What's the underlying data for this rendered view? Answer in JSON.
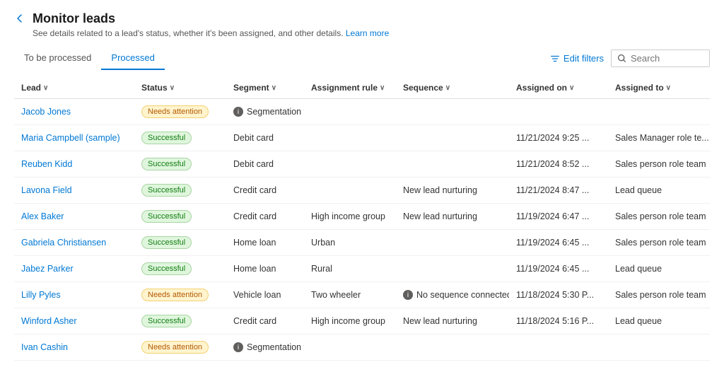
{
  "page": {
    "title": "Monitor leads",
    "subtitle": "See details related to a lead's status, whether it's been assigned, and other details.",
    "learn_more": "Learn more"
  },
  "tabs": [
    {
      "id": "to-be-processed",
      "label": "To be processed",
      "active": false
    },
    {
      "id": "processed",
      "label": "Processed",
      "active": true
    }
  ],
  "toolbar": {
    "edit_filters": "Edit filters",
    "search_placeholder": "Search"
  },
  "columns": [
    {
      "id": "lead",
      "label": "Lead"
    },
    {
      "id": "status",
      "label": "Status"
    },
    {
      "id": "segment",
      "label": "Segment"
    },
    {
      "id": "assignment_rule",
      "label": "Assignment rule"
    },
    {
      "id": "sequence",
      "label": "Sequence"
    },
    {
      "id": "assigned_on",
      "label": "Assigned on"
    },
    {
      "id": "assigned_to",
      "label": "Assigned to"
    }
  ],
  "rows": [
    {
      "lead": "Jacob Jones",
      "status": "Needs attention",
      "status_type": "attention",
      "segment": "",
      "segment_failed": true,
      "segment_failed_text": "Segmentation failed",
      "assignment_rule": "",
      "sequence": "",
      "no_sequence": false,
      "assigned_on": "",
      "assigned_to": ""
    },
    {
      "lead": "Maria Campbell (sample)",
      "status": "Successful",
      "status_type": "success",
      "segment": "Debit card",
      "segment_failed": false,
      "assignment_rule": "",
      "sequence": "",
      "no_sequence": false,
      "assigned_on": "11/21/2024 9:25 ...",
      "assigned_to": "Sales Manager role te..."
    },
    {
      "lead": "Reuben Kidd",
      "status": "Successful",
      "status_type": "success",
      "segment": "Debit card",
      "segment_failed": false,
      "assignment_rule": "",
      "sequence": "",
      "no_sequence": false,
      "assigned_on": "11/21/2024 8:52 ...",
      "assigned_to": "Sales person role team"
    },
    {
      "lead": "Lavona Field",
      "status": "Successful",
      "status_type": "success",
      "segment": "Credit card",
      "segment_failed": false,
      "assignment_rule": "",
      "sequence": "New lead nurturing",
      "no_sequence": false,
      "assigned_on": "11/21/2024 8:47 ...",
      "assigned_to": "Lead queue"
    },
    {
      "lead": "Alex Baker",
      "status": "Successful",
      "status_type": "success",
      "segment": "Credit card",
      "segment_failed": false,
      "assignment_rule": "High income group",
      "sequence": "New lead nurturing",
      "no_sequence": false,
      "assigned_on": "11/19/2024 6:47 ...",
      "assigned_to": "Sales person role team"
    },
    {
      "lead": "Gabriela Christiansen",
      "status": "Successful",
      "status_type": "success",
      "segment": "Home loan",
      "segment_failed": false,
      "assignment_rule": "Urban",
      "sequence": "",
      "no_sequence": false,
      "assigned_on": "11/19/2024 6:45 ...",
      "assigned_to": "Sales person role team"
    },
    {
      "lead": "Jabez Parker",
      "status": "Successful",
      "status_type": "success",
      "segment": "Home loan",
      "segment_failed": false,
      "assignment_rule": "Rural",
      "sequence": "",
      "no_sequence": false,
      "assigned_on": "11/19/2024 6:45 ...",
      "assigned_to": "Lead queue"
    },
    {
      "lead": "Lilly Pyles",
      "status": "Needs attention",
      "status_type": "attention",
      "segment": "Vehicle loan",
      "segment_failed": false,
      "assignment_rule": "Two wheeler",
      "sequence": "",
      "no_sequence": true,
      "no_sequence_text": "No sequence connected",
      "assigned_on": "11/18/2024 5:30 P...",
      "assigned_to": "Sales person role team"
    },
    {
      "lead": "Winford Asher",
      "status": "Successful",
      "status_type": "success",
      "segment": "Credit card",
      "segment_failed": false,
      "assignment_rule": "High income group",
      "sequence": "New lead nurturing",
      "no_sequence": false,
      "assigned_on": "11/18/2024 5:16 P...",
      "assigned_to": "Lead queue"
    },
    {
      "lead": "Ivan Cashin",
      "status": "Needs attention",
      "status_type": "attention",
      "segment": "",
      "segment_failed": true,
      "segment_failed_text": "Segmentation failed",
      "assignment_rule": "",
      "sequence": "",
      "no_sequence": false,
      "assigned_on": "",
      "assigned_to": ""
    }
  ]
}
